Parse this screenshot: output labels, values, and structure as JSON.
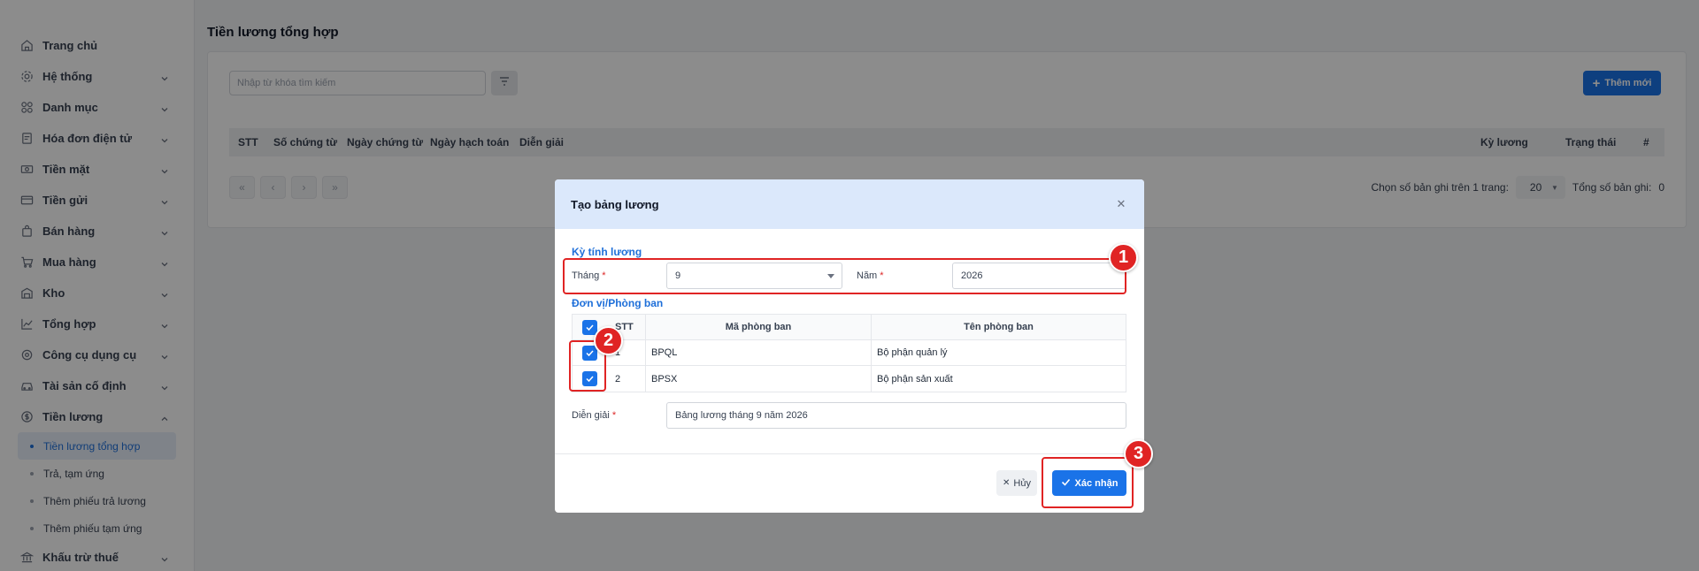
{
  "sidebar": {
    "items": [
      {
        "label": "Trang chủ",
        "icon": "home-icon"
      },
      {
        "label": "Hệ thống",
        "icon": "gear-icon"
      },
      {
        "label": "Danh mục",
        "icon": "grid-icon"
      },
      {
        "label": "Hóa đơn điện tử",
        "icon": "invoice-icon"
      },
      {
        "label": "Tiền mặt",
        "icon": "cash-icon"
      },
      {
        "label": "Tiền gửi",
        "icon": "card-icon"
      },
      {
        "label": "Bán hàng",
        "icon": "bag-icon"
      },
      {
        "label": "Mua hàng",
        "icon": "cart-icon"
      },
      {
        "label": "Kho",
        "icon": "warehouse-icon"
      },
      {
        "label": "Tổng hợp",
        "icon": "chart-icon"
      },
      {
        "label": "Công cụ dụng cụ",
        "icon": "tools-icon"
      },
      {
        "label": "Tài sản cố định",
        "icon": "car-icon"
      },
      {
        "label": "Tiền lương",
        "icon": "dollar-icon"
      },
      {
        "label": "Khấu trừ thuế",
        "icon": "bank-icon"
      }
    ],
    "sub_items": [
      {
        "label": "Tiền lương tổng hợp",
        "active": true
      },
      {
        "label": "Trả, tạm ứng",
        "active": false
      },
      {
        "label": "Thêm phiếu trả lương",
        "active": false
      },
      {
        "label": "Thêm phiếu tạm ứng",
        "active": false
      }
    ]
  },
  "page": {
    "title": "Tiền lương tổng hợp",
    "search_placeholder": "Nhập từ khóa tìm kiếm",
    "add_button": "Thêm mới",
    "columns": [
      "STT",
      "Số chứng từ",
      "Ngày chứng từ",
      "Ngày hạch toán",
      "Diễn giải",
      "Kỳ lương",
      "Trạng thái",
      "#"
    ],
    "pagination": {
      "per_page_label": "Chọn số bản ghi trên 1 trang:",
      "per_page": "20",
      "total_label": "Tổng số bản ghi:",
      "total": "0"
    }
  },
  "modal": {
    "title": "Tạo bảng lương",
    "period_section": "Kỳ tính lương",
    "month_label": "Tháng",
    "month_value": "9",
    "year_label": "Năm",
    "year_value": "2026",
    "dept_section": "Đơn vị/Phòng ban",
    "table_headers": {
      "stt": "STT",
      "code": "Mã phòng ban",
      "name": "Tên phòng ban"
    },
    "rows": [
      {
        "stt": "1",
        "code": "BPQL",
        "name": "Bộ phận quản lý",
        "checked": true
      },
      {
        "stt": "2",
        "code": "BPSX",
        "name": "Bộ phận sản xuất",
        "checked": true
      }
    ],
    "description_label": "Diễn giải",
    "description_value": "Bảng lương tháng 9 năm 2026",
    "cancel_label": "Hủy",
    "confirm_label": "Xác nhận",
    "required_mark": "*"
  },
  "annotations": [
    "1",
    "2",
    "3"
  ],
  "colors": {
    "accent": "#1a73e8",
    "annotation": "#e02424",
    "header_bg": "#dbe8fb"
  }
}
